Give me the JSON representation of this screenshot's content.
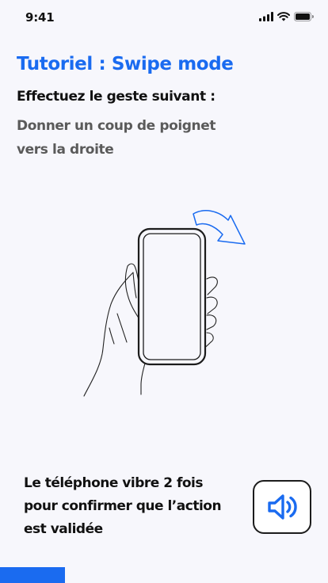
{
  "status_bar": {
    "time": "9:41",
    "icons": [
      "cellular-signal-icon",
      "wifi-icon",
      "battery-icon"
    ]
  },
  "tutorial": {
    "title": "Tutoriel : Swipe mode",
    "instruction": "Effectuez le geste suivant :",
    "gesture": "Donner un coup de poignet vers la droite"
  },
  "illustration": {
    "icon": "hand-phone-swipe-right-illustration"
  },
  "confirmation": {
    "text": "Le téléphone vibre 2 fois pour confirmer que l’action est validée"
  },
  "sound_button": {
    "icon": "speaker-volume-icon"
  },
  "colors": {
    "accent": "#1a6bf0",
    "background": "#f7f7fc",
    "text": "#111111",
    "muted_text": "#5a5a5a"
  }
}
